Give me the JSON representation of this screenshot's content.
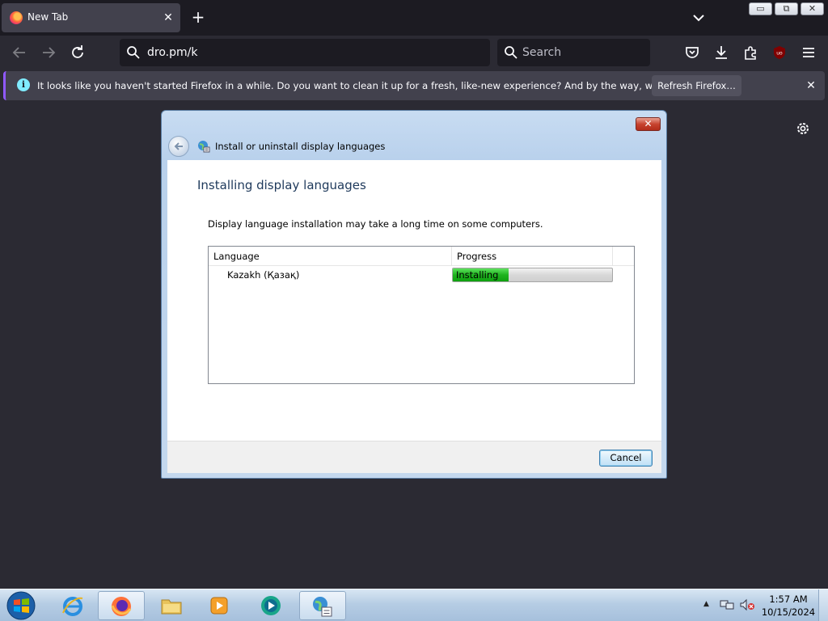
{
  "browser": {
    "tab": {
      "title": "New Tab",
      "close_glyph": "✕",
      "icon": "firefox-icon"
    },
    "new_tab_glyph": "+",
    "window_buttons": {
      "minimize": "▭",
      "restore": "⧉",
      "close": "✕"
    },
    "url": "dro.pm/k",
    "search_placeholder": "Search",
    "notification": {
      "message": "It looks like you haven't started Firefox in a while. Do you want to clean it up for a fresh, like-new experience? And by the way, welcome back!",
      "button": "Refresh Firefox…",
      "close_glyph": "✕"
    },
    "colors": {
      "chrome_dark": "#1c1b22",
      "page": "#2b2a33",
      "accent": "#9059ff",
      "info": "#80ebff"
    }
  },
  "dialog": {
    "close_glyph": "✕",
    "breadcrumb": "Install or uninstall display languages",
    "heading": "Installing display languages",
    "description": "Display language installation may take a long time on some computers.",
    "columns": [
      "Language",
      "Progress"
    ],
    "rows": [
      {
        "language": "Kazakh (Қазақ)",
        "status": "Installing",
        "progress": 0.35
      }
    ],
    "cancel_label": "Cancel",
    "colors": {
      "heading": "#1e395b",
      "progress_fill": "#1fb31f"
    }
  },
  "taskbar": {
    "apps": [
      "internet-explorer-icon",
      "firefox-icon",
      "file-explorer-icon",
      "media-player-icon",
      "media-center-icon",
      "language-settings-icon"
    ],
    "tray": {
      "arrow": "▲",
      "time": "1:57 AM",
      "date": "10/15/2024"
    }
  }
}
